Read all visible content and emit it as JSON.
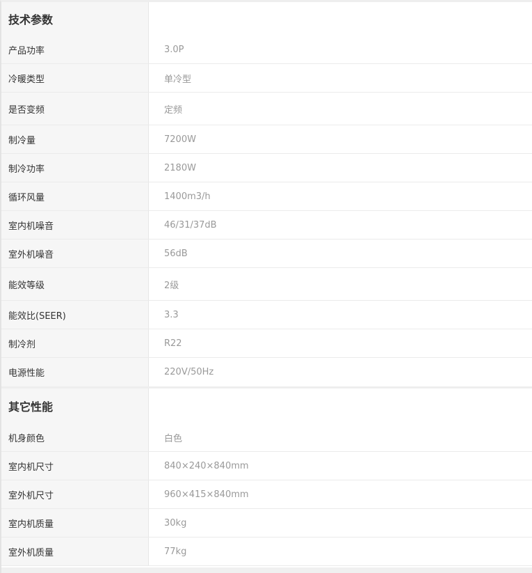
{
  "sections": [
    {
      "title": "技术参数",
      "rows": [
        {
          "label": "产品功率",
          "value": "3.0P"
        },
        {
          "label": "冷暖类型",
          "value": "单冷型"
        },
        {
          "label": "是否变频",
          "value": "定频"
        },
        {
          "label": "制冷量",
          "value": "7200W"
        },
        {
          "label": "制冷功率",
          "value": "2180W"
        },
        {
          "label": "循环风量",
          "value": "1400m3/h"
        },
        {
          "label": "室内机噪音",
          "value": "46/31/37dB"
        },
        {
          "label": "室外机噪音",
          "value": "56dB"
        },
        {
          "label": "能效等级",
          "value": "2级"
        },
        {
          "label": "能效比(SEER)",
          "value": "3.3"
        },
        {
          "label": "制冷剂",
          "value": "R22"
        },
        {
          "label": "电源性能",
          "value": "220V/50Hz"
        }
      ]
    },
    {
      "title": "其它性能",
      "rows": [
        {
          "label": "机身颜色",
          "value": "白色"
        },
        {
          "label": "室内机尺寸",
          "value": "840×240×840mm"
        },
        {
          "label": "室外机尺寸",
          "value": "960×415×840mm"
        },
        {
          "label": "室内机质量",
          "value": "30kg"
        },
        {
          "label": "室外机质量",
          "value": "77kg"
        }
      ]
    }
  ]
}
